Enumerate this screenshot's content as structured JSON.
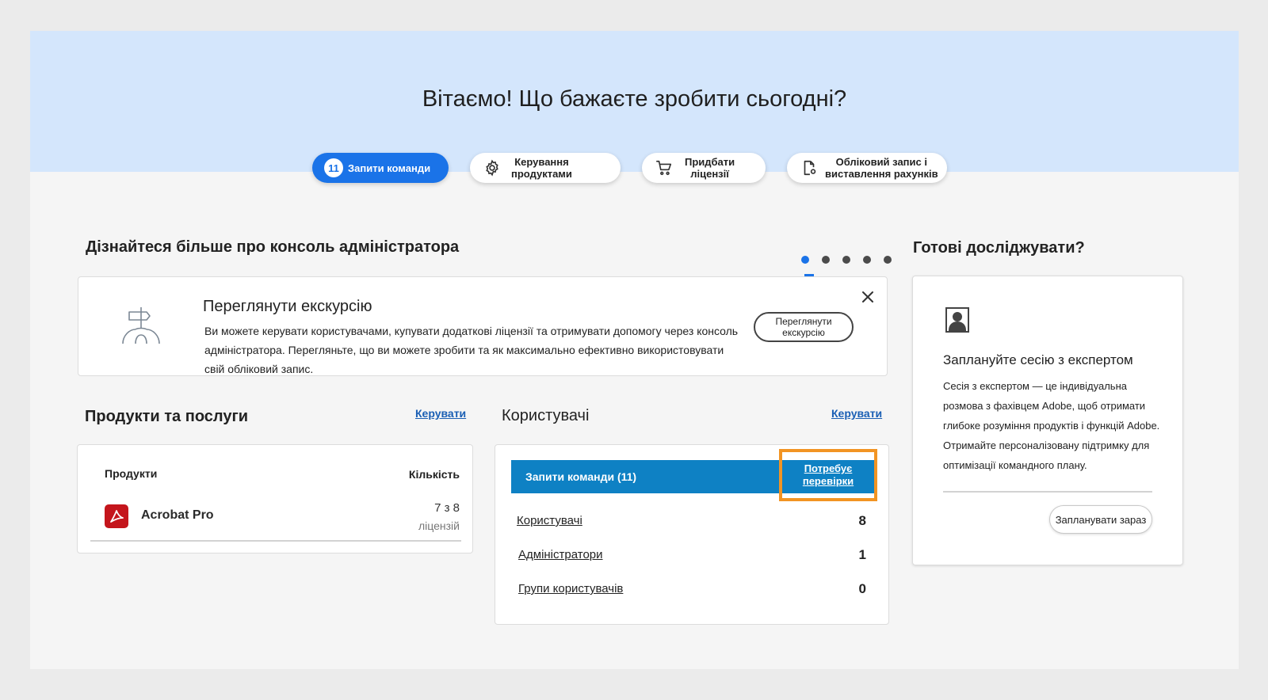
{
  "hero": {
    "title": "Вітаємо! Що бажаєте зробити сьогодні?"
  },
  "quick_actions": {
    "team_requests": {
      "badge": "11",
      "label": "Запити команди"
    },
    "manage_products": {
      "line1": "Керування",
      "line2": "продуктами",
      "icon": "gear-icon"
    },
    "buy_licenses": {
      "line1": "Придбати",
      "line2": "ліцензії",
      "icon": "cart-icon"
    },
    "account_billing": {
      "line1": "Обліковий запис і",
      "line2": "виставлення рахунків",
      "icon": "document-gear-icon"
    }
  },
  "learn_section": {
    "title": "Дізнайтеся більше про консоль адміністратора",
    "carousel_dots": 5,
    "active_dot": 1,
    "tour": {
      "title": "Переглянути екскурсію",
      "line1": "Ви можете керувати користувачами, купувати додаткові ліцензії та отримувати допомогу через консоль",
      "line2": "адміністратора. Перегляньте, що ви можете зробити та як максимально ефективно використовувати",
      "line3": "свій обліковий запис.",
      "button_line1": "Переглянути",
      "button_line2": "екскурсію",
      "icon": "signpost-icon"
    }
  },
  "products": {
    "title": "Продукти та послуги",
    "manage_link": "Керувати",
    "col_product": "Продукти",
    "col_quantity": "Кількість",
    "items": [
      {
        "name": "Acrobat Pro",
        "quantity": "7 з 8",
        "unit": "ліцензій",
        "icon": "acrobat-icon"
      }
    ]
  },
  "users": {
    "title": "Користувачі",
    "manage_link": "Керувати",
    "team_requests": {
      "label": "Запити команди (11)",
      "action_line1": "Потребує",
      "action_line2": "перевірки"
    },
    "rows": [
      {
        "label": "Користувачі",
        "value": "8"
      },
      {
        "label": "Адміністратори",
        "value": "1"
      },
      {
        "label": "Групи користувачів",
        "value": "0"
      }
    ]
  },
  "explore": {
    "title": "Готові досліджувати?",
    "card_title": "Заплануйте сесію з експертом",
    "text_lines": [
      "Сесія з експертом — це індивідуальна",
      "розмова з фахівцем Adobe, щоб отримати",
      "глибоке розуміння продуктів і функцій Adobe.",
      "Отримайте персоналізовану підтримку для",
      "оптимізації командного плану."
    ],
    "button": "Запланувати зараз",
    "icon": "expert-portrait-icon"
  },
  "colors": {
    "accent_blue": "#1a73e8",
    "team_bar": "#0e81c4",
    "highlight_orange": "#f29423",
    "hero_bg": "#d4e6fc",
    "acrobat_red": "#c4151c"
  }
}
